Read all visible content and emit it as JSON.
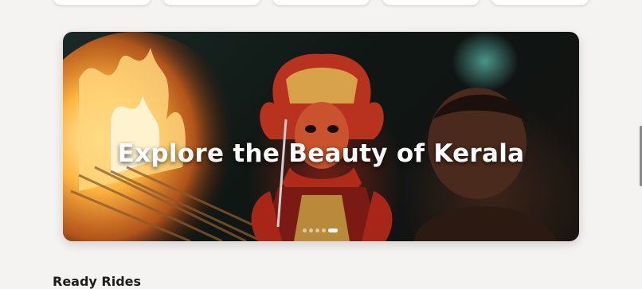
{
  "categories": {
    "count_visible": 5
  },
  "hero": {
    "title": "Explore the Beauty of Kerala",
    "slides_total": 5,
    "active_slide": 5
  },
  "sections": {
    "next_heading": "Ready Rides"
  }
}
